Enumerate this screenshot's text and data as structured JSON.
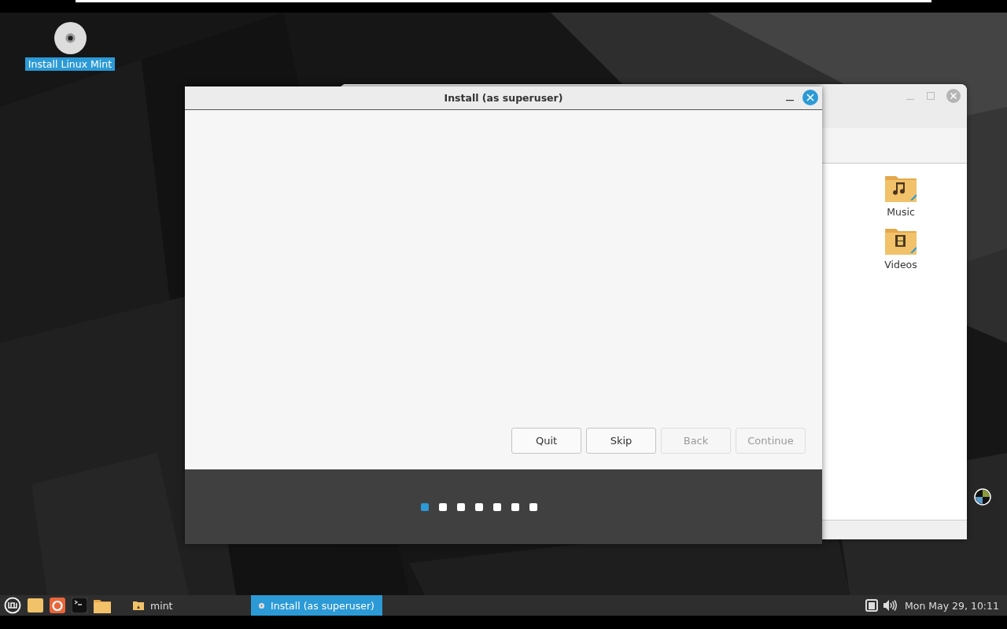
{
  "desktop": {
    "icons": [
      {
        "label": "Install Linux Mint",
        "selected": true
      }
    ]
  },
  "file_manager": {
    "items": [
      {
        "label": "Music",
        "kind": "music"
      },
      {
        "label": "Videos",
        "kind": "video"
      }
    ]
  },
  "installer": {
    "title": "Install (as superuser)",
    "buttons": [
      {
        "label": "Quit",
        "disabled": false
      },
      {
        "label": "Skip",
        "disabled": false
      },
      {
        "label": "Back",
        "disabled": true
      },
      {
        "label": "Continue",
        "disabled": true
      }
    ],
    "steps": [
      {
        "selected": true
      },
      {
        "selected": false
      },
      {
        "selected": false
      },
      {
        "selected": false
      },
      {
        "selected": false
      },
      {
        "selected": false
      },
      {
        "selected": false
      }
    ]
  },
  "taskbar": {
    "launchers": [
      {
        "kind": "menu"
      },
      {
        "kind": "folder"
      },
      {
        "kind": "browser"
      },
      {
        "kind": "terminal"
      },
      {
        "kind": "files"
      }
    ],
    "windows": [
      {
        "label": "mint",
        "kind": "folder",
        "selected": false
      },
      {
        "label": "Install (as superuser)",
        "kind": "disc",
        "selected": true
      }
    ],
    "clock": "Mon May 29, 10:11"
  }
}
